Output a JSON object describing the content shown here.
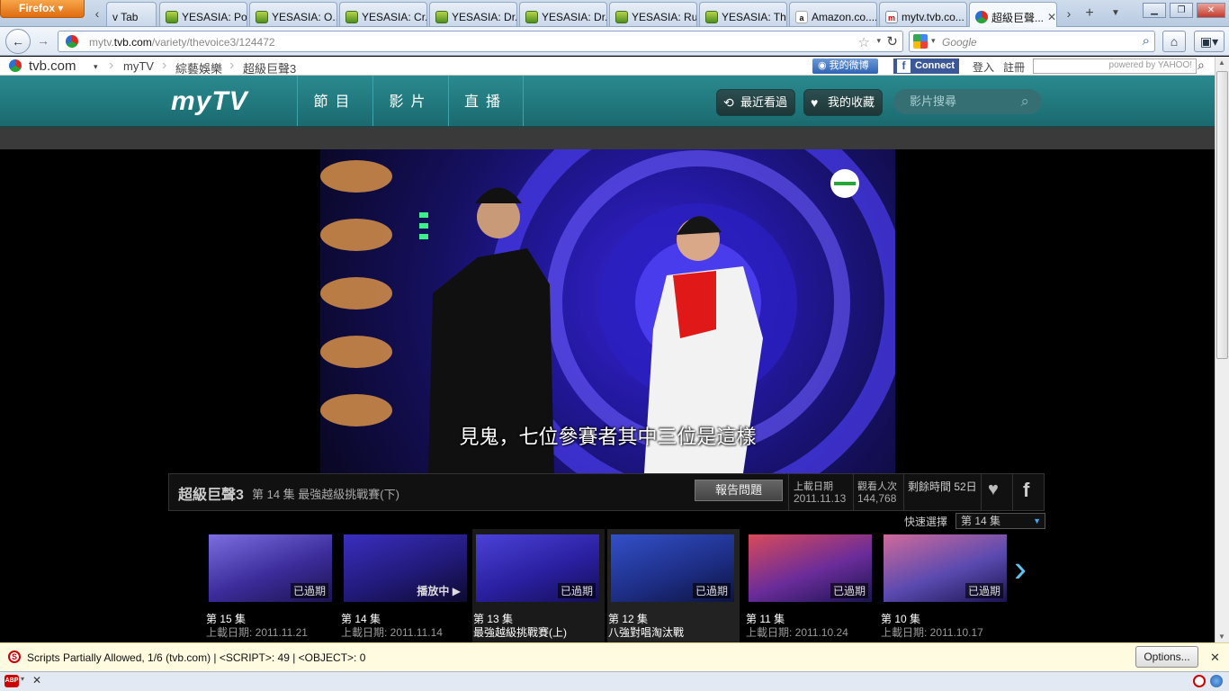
{
  "browser": {
    "app_button": "Firefox",
    "tabs": [
      {
        "label": "v Tab",
        "icon": "new-tab-icon"
      },
      {
        "label": "YESASIA: Po...",
        "icon": "yesasia-icon"
      },
      {
        "label": "YESASIA: O...",
        "icon": "yesasia-icon"
      },
      {
        "label": "YESASIA: Cr...",
        "icon": "yesasia-icon"
      },
      {
        "label": "YESASIA: Dr...",
        "icon": "yesasia-icon"
      },
      {
        "label": "YESASIA: Dr...",
        "icon": "yesasia-icon"
      },
      {
        "label": "YESASIA: Ru...",
        "icon": "yesasia-icon"
      },
      {
        "label": "YESASIA: Th...",
        "icon": "yesasia-icon"
      },
      {
        "label": "Amazon.co....",
        "icon": "amazon-icon"
      },
      {
        "label": "mytv.tvb.co...",
        "icon": "mytv-icon"
      },
      {
        "label": "超級巨聲...",
        "icon": "tvb-icon",
        "active": true
      }
    ],
    "url_prefix": "mytv.",
    "url_domain": "tvb.com",
    "url_path": "/variety/thevoice3/124472",
    "search_placeholder": "Google",
    "accent": "#e06b10"
  },
  "tvb_bar": {
    "site": "tvb.com",
    "crumbs": [
      "myTV",
      "綜藝娛樂",
      "超級巨聲3"
    ],
    "weibo": "我的微博",
    "connect": "Connect",
    "login": "登入",
    "register": "註冊",
    "yahoo_label": "powered by YAHOO!"
  },
  "header": {
    "logo": "myTV",
    "menu": [
      "節目",
      "影片",
      "直播"
    ],
    "recent": "最近看過",
    "favorites": "我的收藏",
    "search_placeholder": "影片搜尋",
    "color": "#1f7a7f"
  },
  "video": {
    "subtitle": "見鬼，七位參賽者其中三位是這樣"
  },
  "info": {
    "show": "超級巨聲3",
    "episode": "第 14 集 最強越級挑戰賽(下)",
    "report": "報告問題",
    "upload_label": "上載日期",
    "upload_value": "2011.11.13",
    "views_label": "觀看人次",
    "views_value": "144,768",
    "remaining": "剩餘時間 52日",
    "quick_select_label": "快速選擇",
    "quick_select_value": "第 14 集"
  },
  "episodes": [
    {
      "num": "第 15 集",
      "title": "上載日期: 2011.11.21",
      "badge": "已過期"
    },
    {
      "num": "第 14 集",
      "title": "上載日期: 2011.11.14",
      "badge": "播放中"
    },
    {
      "num": "第 13 集",
      "title": "最強越級挑戰賽(上)",
      "badge": "已過期"
    },
    {
      "num": "第 12 集",
      "title": "八強對唱淘汰戰",
      "badge": "已過期"
    },
    {
      "num": "第 11 集",
      "title": "上載日期: 2011.10.24",
      "badge": "已過期"
    },
    {
      "num": "第 10 集",
      "title": "上載日期: 2011.10.17",
      "badge": "已過期"
    }
  ],
  "noscript": {
    "message": "Scripts Partially Allowed, 1/6 (tvb.com) | <SCRIPT>: 49 | <OBJECT>: 0",
    "options": "Options..."
  }
}
